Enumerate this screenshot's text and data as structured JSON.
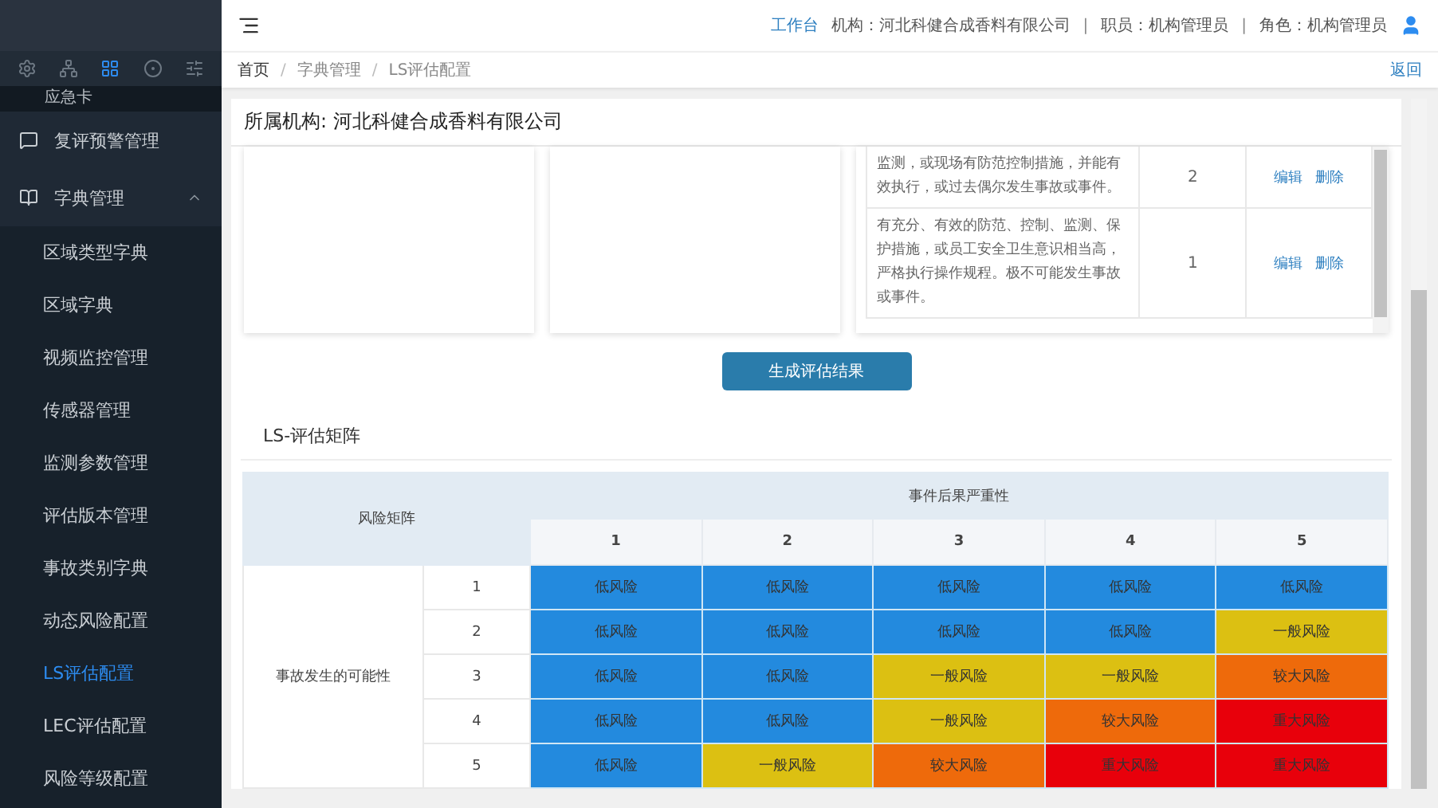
{
  "topbar": {
    "separator": "|",
    "links": [
      {
        "text": "工作台",
        "kind": "link"
      },
      {
        "text": "机构：河北科健合成香料有限公司",
        "kind": "info"
      },
      {
        "text": "职员：机构管理员",
        "kind": "info"
      },
      {
        "text": "角色：机构管理员",
        "kind": "info"
      }
    ]
  },
  "breadcrumb": {
    "separator": "/",
    "items": [
      "首页",
      "字典管理",
      "LS评估配置"
    ],
    "back": "返回"
  },
  "sidebar": {
    "icon_tabs": [
      {
        "selected": false
      },
      {
        "selected": false
      },
      {
        "selected": true
      },
      {
        "selected": false
      },
      {
        "selected": false
      }
    ],
    "cut_item": "应急卡",
    "items": [
      {
        "label": "复评预警管理"
      },
      {
        "label": "字典管理",
        "children": [
          {
            "label": "区域类型字典",
            "selected": false
          },
          {
            "label": "区域字典",
            "selected": false
          },
          {
            "label": "视频监控管理",
            "selected": false
          },
          {
            "label": "传感器管理",
            "selected": false
          },
          {
            "label": "监测参数管理",
            "selected": false
          },
          {
            "label": "评估版本管理",
            "selected": false
          },
          {
            "label": "事故类别字典",
            "selected": false
          },
          {
            "label": "动态风险配置",
            "selected": false
          },
          {
            "label": "LS评估配置",
            "selected": true
          },
          {
            "label": "LEC评估配置",
            "selected": false
          },
          {
            "label": "风险等级配置",
            "selected": false
          }
        ]
      }
    ]
  },
  "org_title": "所属机构: 河北科健合成香料有限公司",
  "criteria_rows": [
    {
      "description": "监测，或现场有防范控制措施，并能有效执行，或过去偶尔发生事故或事件。",
      "score": "2",
      "actions": [
        "编辑",
        "删除"
      ]
    },
    {
      "description": "有充分、有效的防范、控制、监测、保护措施，或员工安全卫生意识相当高，严格执行操作规程。极不可能发生事故或事件。",
      "score": "1",
      "actions": [
        "编辑",
        "删除"
      ]
    }
  ],
  "generate_button": "生成评估结果",
  "matrix": {
    "title": "LS-评估矩阵",
    "corner": "风险矩阵",
    "severity_label": "事件后果严重性",
    "severity_levels": [
      "1",
      "2",
      "3",
      "4",
      "5"
    ],
    "likelihood_label": "事故发生的可能性",
    "rows": [
      {
        "label": "1",
        "cells": [
          {
            "text": "低风险",
            "color": "#238ade"
          },
          {
            "text": "低风险",
            "color": "#238ade"
          },
          {
            "text": "低风险",
            "color": "#238ade"
          },
          {
            "text": "低风险",
            "color": "#238ade"
          },
          {
            "text": "低风险",
            "color": "#238ade"
          }
        ]
      },
      {
        "label": "2",
        "cells": [
          {
            "text": "低风险",
            "color": "#238ade"
          },
          {
            "text": "低风险",
            "color": "#238ade"
          },
          {
            "text": "低风险",
            "color": "#238ade"
          },
          {
            "text": "低风险",
            "color": "#238ade"
          },
          {
            "text": "一般风险",
            "color": "#dcc012"
          }
        ]
      },
      {
        "label": "3",
        "cells": [
          {
            "text": "低风险",
            "color": "#238ade"
          },
          {
            "text": "低风险",
            "color": "#238ade"
          },
          {
            "text": "一般风险",
            "color": "#dcc012"
          },
          {
            "text": "一般风险",
            "color": "#dcc012"
          },
          {
            "text": "较大风险",
            "color": "#ee6a0b"
          }
        ]
      },
      {
        "label": "4",
        "cells": [
          {
            "text": "低风险",
            "color": "#238ade"
          },
          {
            "text": "低风险",
            "color": "#238ade"
          },
          {
            "text": "一般风险",
            "color": "#dcc012"
          },
          {
            "text": "较大风险",
            "color": "#ee6a0b"
          },
          {
            "text": "重大风险",
            "color": "#e8000b"
          }
        ]
      },
      {
        "label": "5",
        "cells": [
          {
            "text": "低风险",
            "color": "#238ade"
          },
          {
            "text": "一般风险",
            "color": "#dcc012"
          },
          {
            "text": "较大风险",
            "color": "#ee6a0b"
          },
          {
            "text": "重大风险",
            "color": "#e8000b"
          },
          {
            "text": "重大风险",
            "color": "#e8000b"
          }
        ]
      }
    ]
  }
}
